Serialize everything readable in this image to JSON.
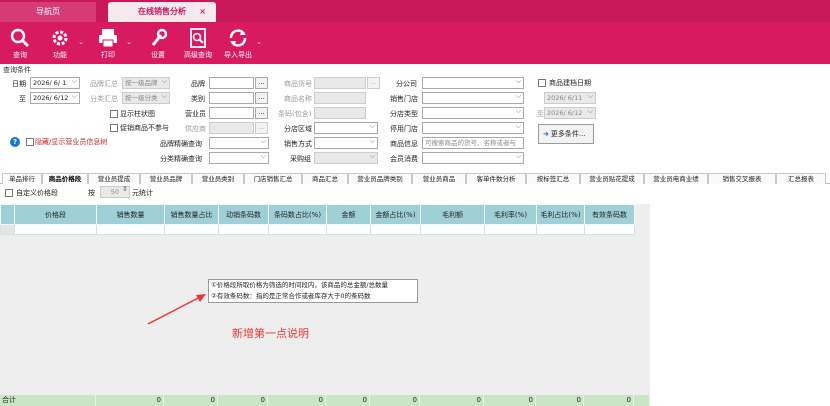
{
  "tabs": {
    "home": "导航页",
    "active": "在线销售分析",
    "close": "×"
  },
  "toolbar": [
    {
      "name": "query",
      "label": "查询",
      "icon": "search-icon"
    },
    {
      "name": "function",
      "label": "功能",
      "icon": "gear-icon",
      "dropdown": true
    },
    {
      "name": "print",
      "label": "打印",
      "icon": "printer-icon",
      "dropdown": true
    },
    {
      "name": "settings",
      "label": "设置",
      "icon": "wrench-icon"
    },
    {
      "name": "advanced-query",
      "label": "高级查询",
      "icon": "advanced-search-icon"
    },
    {
      "name": "import-export",
      "label": "导入导出",
      "icon": "refresh-icon",
      "dropdown": true
    }
  ],
  "conditions": {
    "title": "查询条件",
    "date_label": "日期",
    "date_from": "2026/ 6/ 1",
    "to_label": "至",
    "date_to": "2026/ 6/12",
    "brand_summary_label": "品牌汇总",
    "brand_summary_value": "按一级品牌",
    "category_summary_label": "分类汇总",
    "category_summary_value": "按一级分类",
    "show_bar_chart": "显示柱状图",
    "promo_not_included": "促销商品不参与",
    "supplier_label": "供应商",
    "brand_label": "品牌",
    "category_label": "类别",
    "salesperson_label": "营业员",
    "product_no_label": "商品货号",
    "product_name_label": "商品名称",
    "barcode_label": "条码(包含)",
    "store_area_label": "分店区域",
    "sales_method_label": "销售方式",
    "purchase_group_label": "采购组",
    "brand_precise_label": "品牌精确查询",
    "category_precise_label": "分类精确查询",
    "branch_label": "分公司",
    "sales_store_label": "销售门店",
    "store_type_label": "分店类型",
    "disabled_store_label": "停用门店",
    "product_info_label": "商品信息",
    "product_info_placeholder": "可搜索商品的货号、名称或者与",
    "member_consumption_label": "会员消费",
    "product_create_date_label": "商品建档日期",
    "create_from": "2026/ 6/11",
    "create_to": "2026/ 6/12",
    "more_conditions": "更多条件...",
    "hide_salesperson": "隐藏/显示营业员信息树"
  },
  "report_tabs": [
    "单品排行",
    "商品价格段",
    "营业员提成",
    "营业员品牌",
    "营业员类别",
    "门店销售汇总",
    "商品汇总",
    "营业员品牌类别",
    "营业员商品",
    "客单件数分析",
    "按标签汇总",
    "营业员贴花提成",
    "营业员电商业绩",
    "销售交叉报表",
    "汇总报表"
  ],
  "active_report_tab": 1,
  "price_options": {
    "custom_label": "自定义价格段",
    "step_label": "按",
    "step_value": "50",
    "unit_label": "元统计"
  },
  "grid": {
    "columns": [
      "价格段",
      "销售数量",
      "销售数量占比",
      "动销条码数",
      "条码数占比(%)",
      "金额",
      "金额占比(%)",
      "毛利额",
      "毛利率(%)",
      "毛利占比(%)",
      "有效条码数"
    ],
    "total_label": "合计",
    "totals": [
      "0",
      "0",
      "0",
      "0",
      "0",
      "0",
      "0",
      "0",
      "0",
      "0"
    ]
  },
  "note": {
    "line1": "①价格段所取价格为筛选的时间段内，该商品的总金额/总数量",
    "line2": "②有效条码数：指的是正常合作或者库存大于0的条码数",
    "annotation": "新增第一点说明"
  },
  "colors": {
    "brand": "#d81b60",
    "header": "#9fd0d7",
    "footer": "#c9e6c4",
    "accent_red": "#e53935"
  }
}
